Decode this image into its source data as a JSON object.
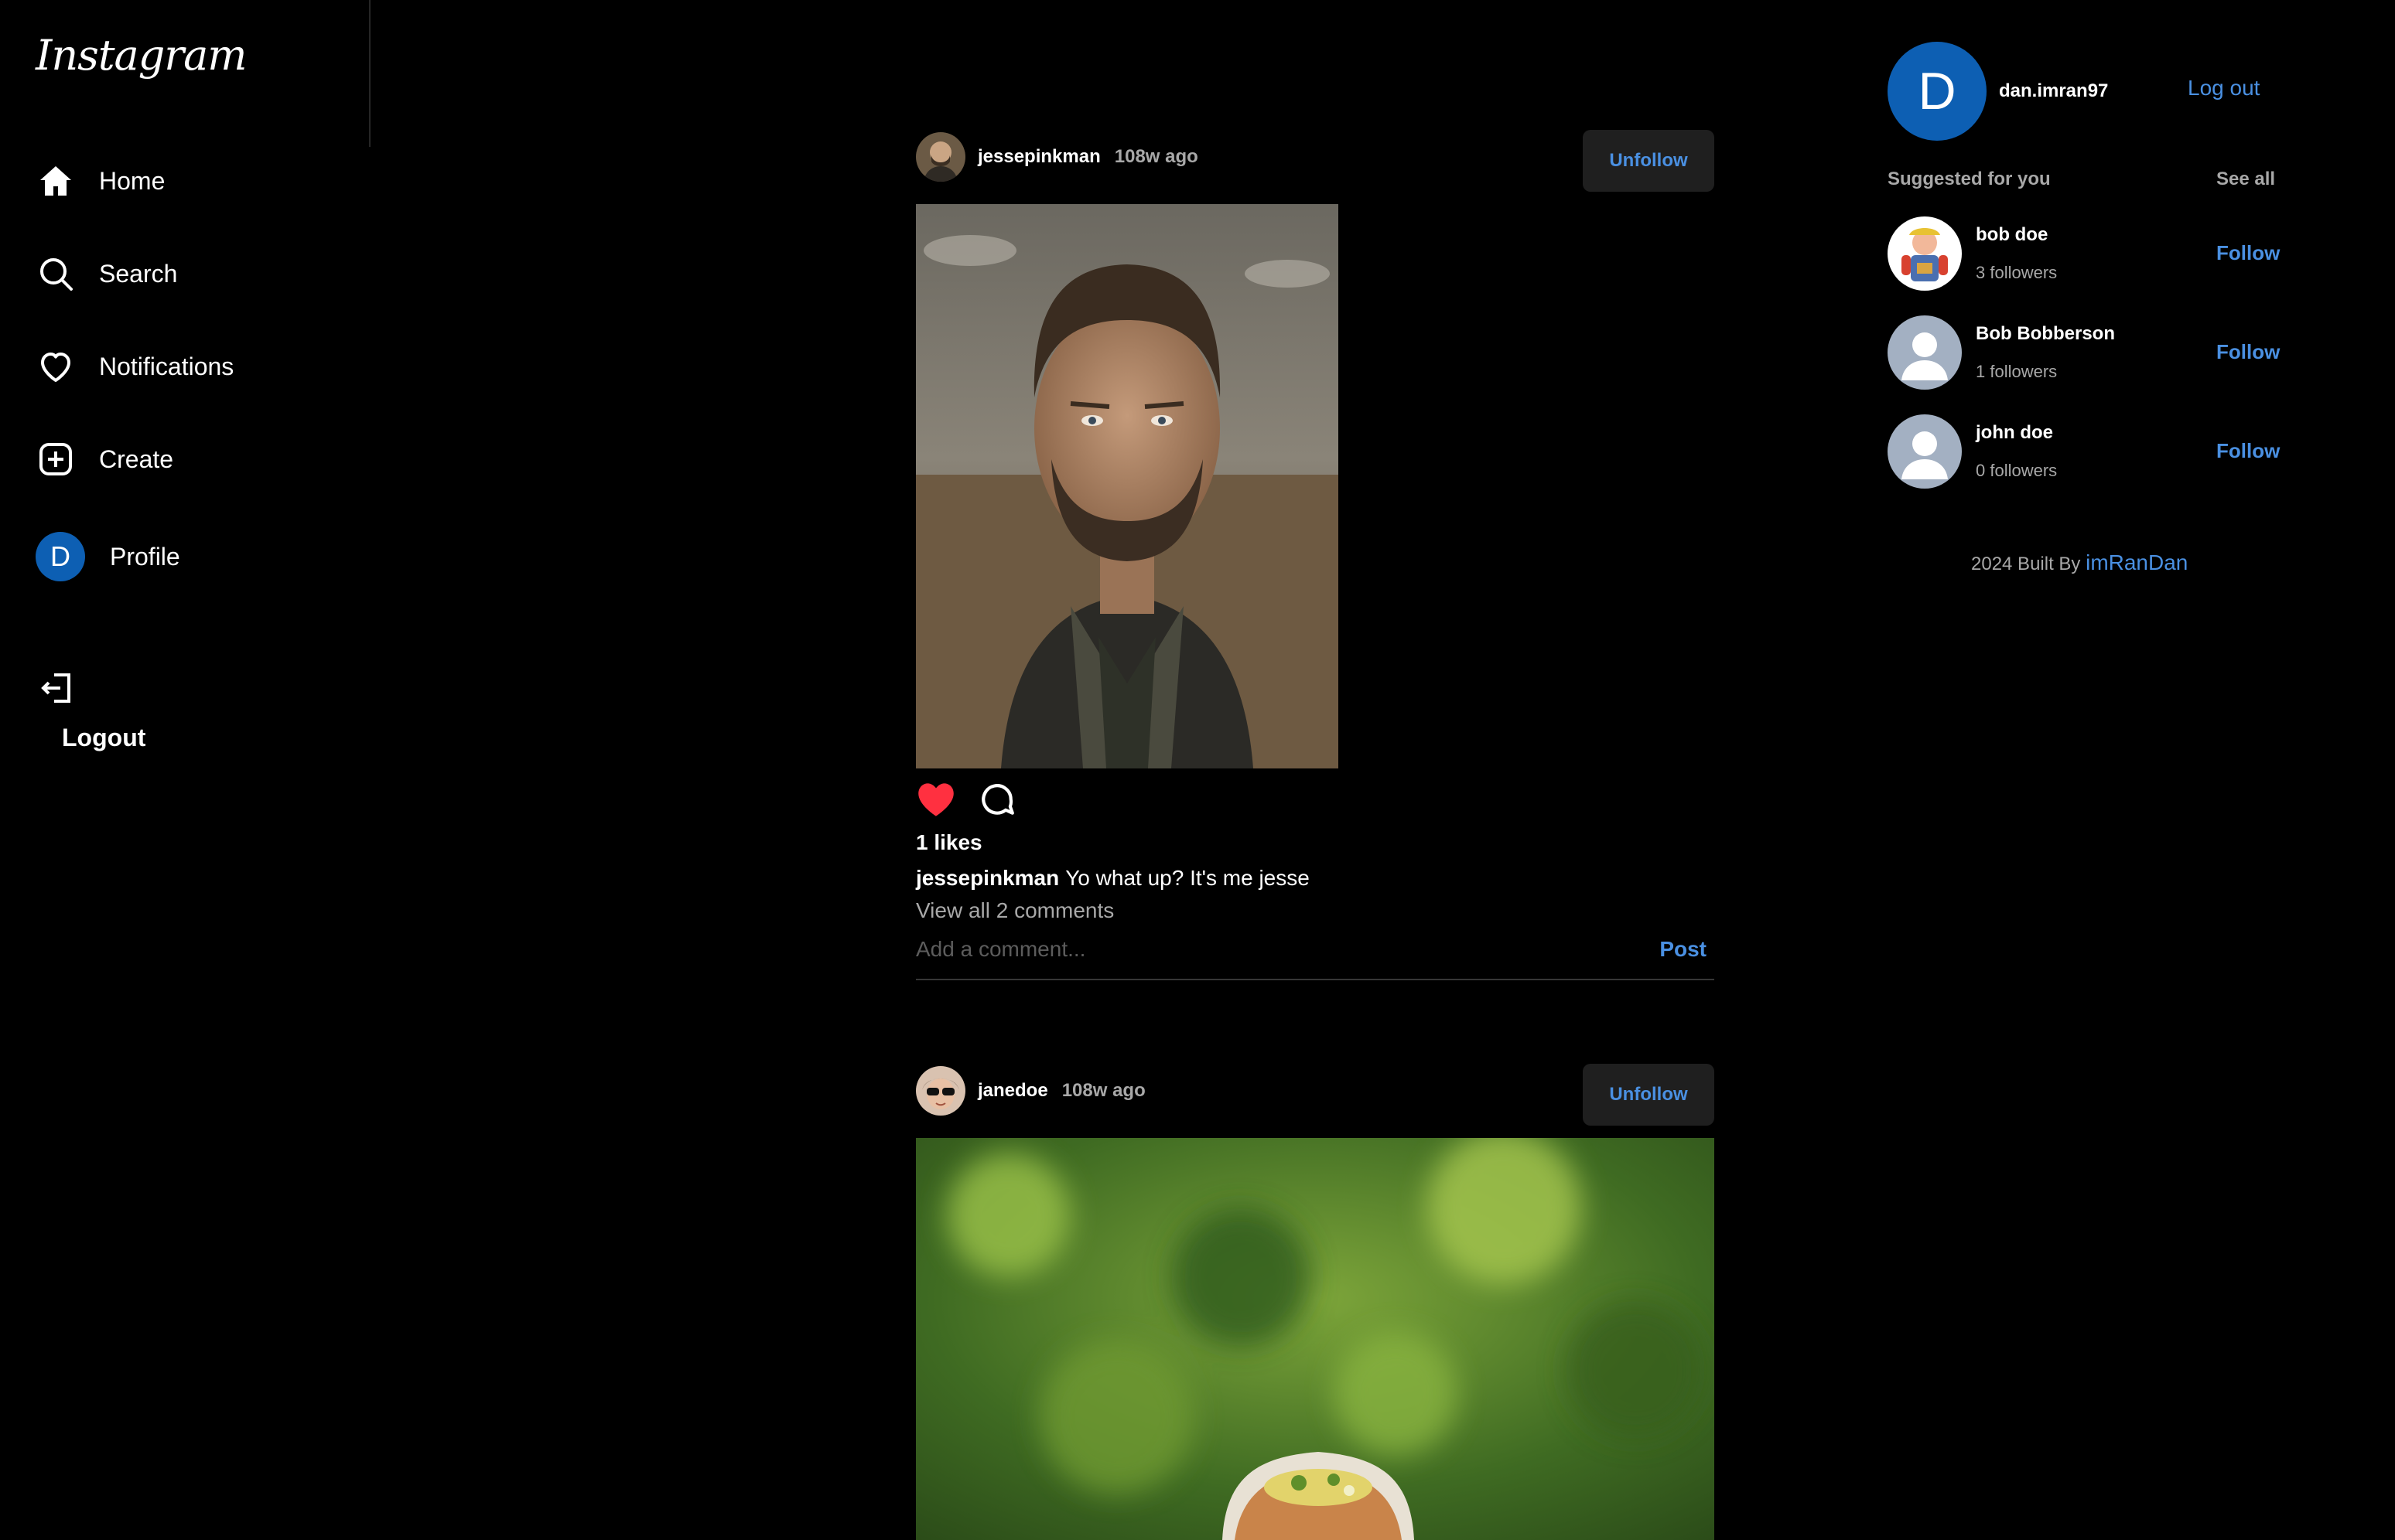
{
  "sidebar": {
    "logo": "Instagram",
    "items": [
      {
        "label": "Home",
        "icon": "home-icon"
      },
      {
        "label": "Search",
        "icon": "search-icon"
      },
      {
        "label": "Notifications",
        "icon": "heart-icon"
      },
      {
        "label": "Create",
        "icon": "plus-square-icon"
      },
      {
        "label": "Profile",
        "icon": "avatar",
        "initial": "D"
      }
    ],
    "logout": "Logout"
  },
  "feed": {
    "posts": [
      {
        "username": "jessepinkman",
        "time": "108w ago",
        "follow_label": "Unfollow",
        "liked": true,
        "likes": "1 likes",
        "caption_user": "jessepinkman",
        "caption": "Yo what up? It's me jesse",
        "view_comments": "View all 2 comments",
        "comment_placeholder": "Add a comment...",
        "post_label": "Post"
      },
      {
        "username": "janedoe",
        "time": "108w ago",
        "follow_label": "Unfollow"
      }
    ]
  },
  "right": {
    "me": {
      "initial": "D",
      "username": "dan.imran97",
      "logout": "Log out"
    },
    "suggested_title": "Suggested for you",
    "see_all": "See all",
    "suggestions": [
      {
        "name": "bob doe",
        "followers": "3 followers",
        "action": "Follow"
      },
      {
        "name": "Bob Bobberson",
        "followers": "1 followers",
        "action": "Follow"
      },
      {
        "name": "john doe",
        "followers": "0 followers",
        "action": "Follow"
      }
    ],
    "footer_text": "2024 Built By",
    "footer_link": "imRanDan"
  },
  "colors": {
    "accent": "#4a90e2",
    "like": "#ff3040",
    "avatar": "#0d5fb3",
    "background": "#000000"
  }
}
